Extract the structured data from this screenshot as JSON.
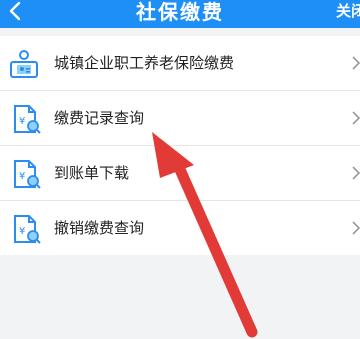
{
  "header": {
    "title": "社保缴费",
    "close_label": "关闭"
  },
  "menu": {
    "items": [
      {
        "label": "城镇企业职工养老保险缴费",
        "icon": "id-card-icon"
      },
      {
        "label": "缴费记录查询",
        "icon": "document-search-icon"
      },
      {
        "label": "到账单下载",
        "icon": "document-search-icon"
      },
      {
        "label": "撤销缴费查询",
        "icon": "document-search-icon"
      }
    ]
  },
  "colors": {
    "header_bg": "#1e8ff7",
    "icon_blue": "#2d8cf0",
    "arrow_red": "#e23a36",
    "page_bg": "#f2f3f5"
  }
}
